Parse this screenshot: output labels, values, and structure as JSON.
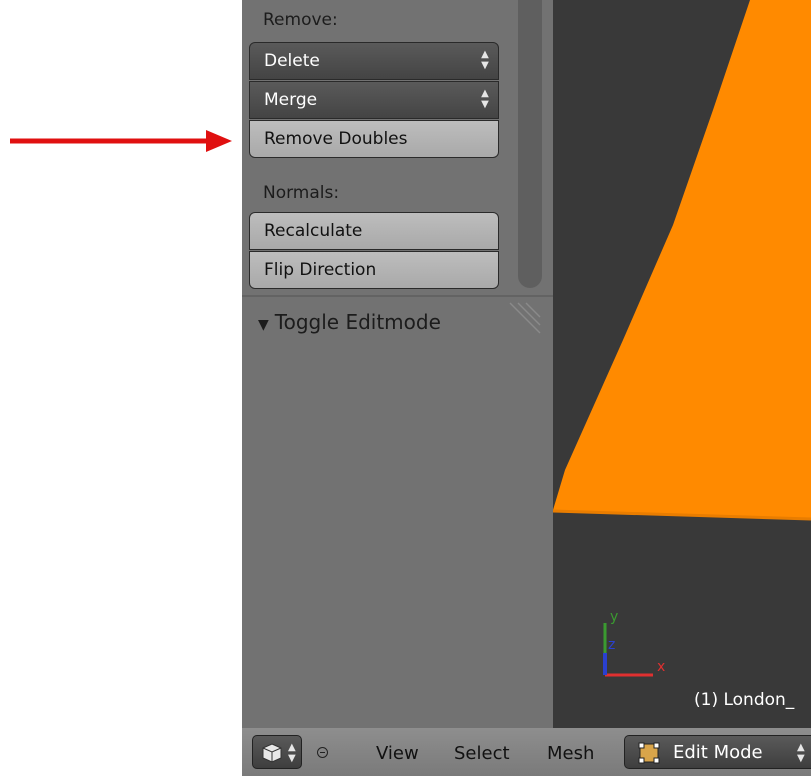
{
  "annotation": {
    "color": "#e01010"
  },
  "tool_shelf": {
    "remove": {
      "label": "Remove:",
      "buttons": [
        "Delete",
        "Merge",
        "Remove Doubles"
      ]
    },
    "normals": {
      "label": "Normals:",
      "buttons": [
        "Recalculate",
        "Flip Direction"
      ]
    },
    "toggle_panel": {
      "label": "Toggle Editmode",
      "icon": "triangle-down-icon"
    }
  },
  "viewport": {
    "mesh_color": "#ff8a00",
    "background": "#393939",
    "axes": {
      "x": "x",
      "y": "y",
      "z": "z"
    },
    "object_label": "(1) London_"
  },
  "header": {
    "editor_icon": "cube-icon",
    "menus": [
      "View",
      "Select",
      "Mesh"
    ],
    "mode": "Edit Mode",
    "mode_icon": "edit-mode-icon"
  }
}
